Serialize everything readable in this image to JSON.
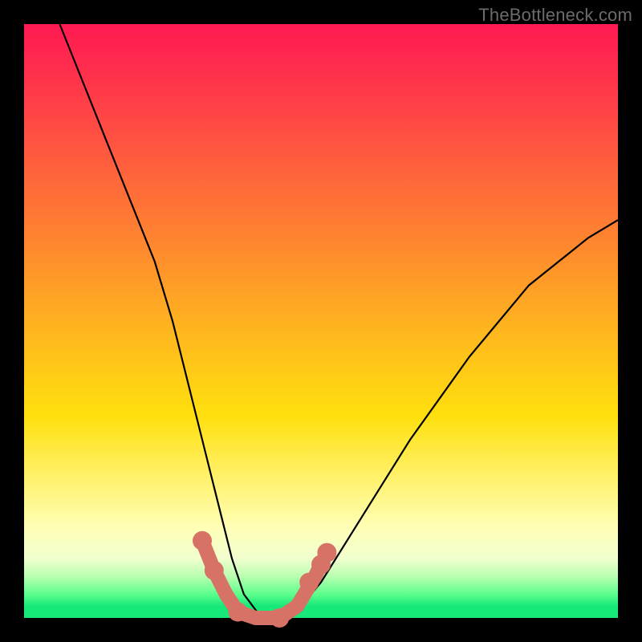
{
  "watermark": "TheBottleneck.com",
  "chart_data": {
    "type": "line",
    "title": "",
    "xlabel": "",
    "ylabel": "",
    "xlim": [
      0,
      100
    ],
    "ylim": [
      0,
      100
    ],
    "grid": false,
    "legend": false,
    "series": [
      {
        "name": "bottleneck-curve",
        "color": "#000000",
        "x": [
          6,
          10,
          14,
          18,
          22,
          25,
          27,
          29,
          31,
          33,
          35,
          37,
          40,
          45,
          50,
          55,
          60,
          65,
          70,
          75,
          80,
          85,
          90,
          95,
          100
        ],
        "y": [
          100,
          90,
          80,
          70,
          60,
          50,
          42,
          34,
          26,
          18,
          10,
          4,
          0,
          0,
          6,
          14,
          22,
          30,
          37,
          44,
          50,
          56,
          60,
          64,
          67
        ]
      },
      {
        "name": "highlight-path",
        "color": "#d77366",
        "x": [
          30,
          32,
          34,
          36,
          39,
          43,
          46,
          49,
          51
        ],
        "y": [
          13,
          8,
          4,
          1,
          0,
          0,
          2,
          7,
          11
        ]
      }
    ],
    "markers": {
      "name": "highlight-dots",
      "color": "#d77366",
      "points": [
        {
          "x": 30,
          "y": 13
        },
        {
          "x": 32,
          "y": 8
        },
        {
          "x": 36,
          "y": 1
        },
        {
          "x": 43,
          "y": 0
        },
        {
          "x": 48,
          "y": 6
        },
        {
          "x": 50,
          "y": 9
        },
        {
          "x": 51,
          "y": 11
        }
      ]
    }
  }
}
